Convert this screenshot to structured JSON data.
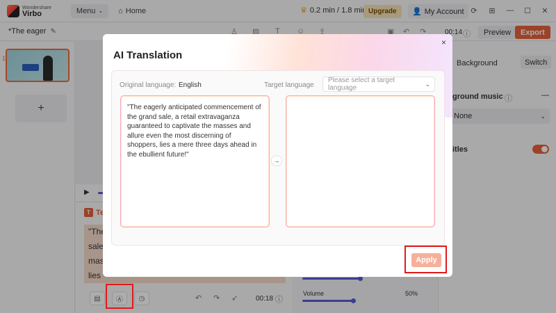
{
  "app": {
    "brand": "Wondershare",
    "name": "Virbo",
    "menu_label": "Menu",
    "home_label": "Home",
    "usage": "0.2 min / 1.8 min",
    "upgrade_label": "Upgrade",
    "account_label": "My Account"
  },
  "toolbar": {
    "doc_title": "*The eager",
    "time": "00:14",
    "preview_label": "Preview",
    "export_label": "Export"
  },
  "slides": {
    "items": [
      {
        "number": "1"
      }
    ],
    "add_label": "+"
  },
  "script": {
    "label": "Te",
    "lines": [
      "\"The",
      "sale",
      "mass",
      "lies"
    ],
    "duration": "00:18"
  },
  "right_panel": {
    "background_label": "Background",
    "switch_label": "Switch",
    "bg_music_label": "ground music",
    "bg_music_value": "None",
    "subtitles_label": "itles",
    "volume_label": "Volume",
    "volume_value": "50%",
    "volume_level": 0.5
  },
  "dialog": {
    "title": "AI Translation",
    "original_language_label": "Original language:",
    "original_language_value": "English",
    "target_language_label": "Target language",
    "target_language_placeholder": "Please select a target language",
    "source_text": "\"The eagerly anticipated commencement of the grand sale, a retail extravaganza guaranteed to captivate the masses and allure even the most discerning of shoppers, lies a mere three days ahead in the ebullient future!\"",
    "target_text": "",
    "arrow": "→",
    "apply_label": "Apply",
    "close": "×"
  },
  "colors": {
    "accent": "#e8613c",
    "highlight_box": "#e11919",
    "apply_disabled": "#f6b09a"
  }
}
